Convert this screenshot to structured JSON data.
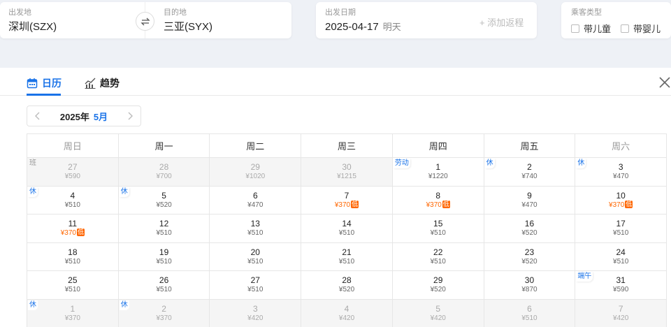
{
  "search": {
    "from": {
      "label": "出发地",
      "value": "深圳(SZX)"
    },
    "to": {
      "label": "目的地",
      "value": "三亚(SYX)"
    },
    "date": {
      "label": "出发日期",
      "value": "2025-04-17",
      "sub": "明天"
    },
    "add_return": "+ 添加返程",
    "passenger": {
      "label": "乘客类型",
      "options": [
        "带儿童",
        "带婴儿"
      ]
    }
  },
  "tabs": {
    "calendar": "日历",
    "trend": "趋势"
  },
  "month_nav": {
    "year": "2025年",
    "month": "5月"
  },
  "weekdays": [
    "周日",
    "周一",
    "周二",
    "周三",
    "周四",
    "周五",
    "周六"
  ],
  "weeks": [
    [
      {
        "day": "27",
        "price": "¥590",
        "badge": "班",
        "out": true
      },
      {
        "day": "28",
        "price": "¥700",
        "out": true
      },
      {
        "day": "29",
        "price": "¥1020",
        "out": true
      },
      {
        "day": "30",
        "price": "¥1215",
        "out": true
      },
      {
        "day": "1",
        "price": "¥1220",
        "badge": "劳动"
      },
      {
        "day": "2",
        "price": "¥740",
        "badge": "休"
      },
      {
        "day": "3",
        "price": "¥470",
        "badge": "休"
      }
    ],
    [
      {
        "day": "4",
        "price": "¥510",
        "badge": "休"
      },
      {
        "day": "5",
        "price": "¥520",
        "badge": "休"
      },
      {
        "day": "6",
        "price": "¥470"
      },
      {
        "day": "7",
        "price": "¥370",
        "low": true,
        "low_text": "低"
      },
      {
        "day": "8",
        "price": "¥370",
        "low": true,
        "low_text": "低"
      },
      {
        "day": "9",
        "price": "¥470"
      },
      {
        "day": "10",
        "price": "¥370",
        "low": true,
        "low_text": "低"
      }
    ],
    [
      {
        "day": "11",
        "price": "¥370",
        "low": true,
        "low_text": "低"
      },
      {
        "day": "12",
        "price": "¥510"
      },
      {
        "day": "13",
        "price": "¥510"
      },
      {
        "day": "14",
        "price": "¥510"
      },
      {
        "day": "15",
        "price": "¥510"
      },
      {
        "day": "16",
        "price": "¥520"
      },
      {
        "day": "17",
        "price": "¥510"
      }
    ],
    [
      {
        "day": "18",
        "price": "¥510"
      },
      {
        "day": "19",
        "price": "¥510"
      },
      {
        "day": "20",
        "price": "¥510"
      },
      {
        "day": "21",
        "price": "¥510"
      },
      {
        "day": "22",
        "price": "¥510"
      },
      {
        "day": "23",
        "price": "¥520"
      },
      {
        "day": "24",
        "price": "¥510"
      }
    ],
    [
      {
        "day": "25",
        "price": "¥510"
      },
      {
        "day": "26",
        "price": "¥510"
      },
      {
        "day": "27",
        "price": "¥510"
      },
      {
        "day": "28",
        "price": "¥520"
      },
      {
        "day": "29",
        "price": "¥520"
      },
      {
        "day": "30",
        "price": "¥870"
      },
      {
        "day": "31",
        "price": "¥590",
        "badge": "端午"
      }
    ],
    [
      {
        "day": "1",
        "price": "¥370",
        "badge": "休",
        "badge_blue": true,
        "out": true
      },
      {
        "day": "2",
        "price": "¥370",
        "badge": "休",
        "badge_blue": true,
        "out": true
      },
      {
        "day": "3",
        "price": "¥420",
        "out": true
      },
      {
        "day": "4",
        "price": "¥420",
        "out": true
      },
      {
        "day": "5",
        "price": "¥420",
        "out": true
      },
      {
        "day": "6",
        "price": "¥510",
        "out": true
      },
      {
        "day": "7",
        "price": "¥420",
        "out": true
      }
    ]
  ],
  "colors": {
    "accent": "#1a73e8",
    "low": "#ff6600"
  },
  "icons": {
    "swap": "swap-arrows-icon",
    "calendar": "calendar-icon",
    "trend": "trend-chart-icon",
    "close": "close-icon",
    "prev": "chevron-left-icon",
    "next": "chevron-right-icon"
  }
}
